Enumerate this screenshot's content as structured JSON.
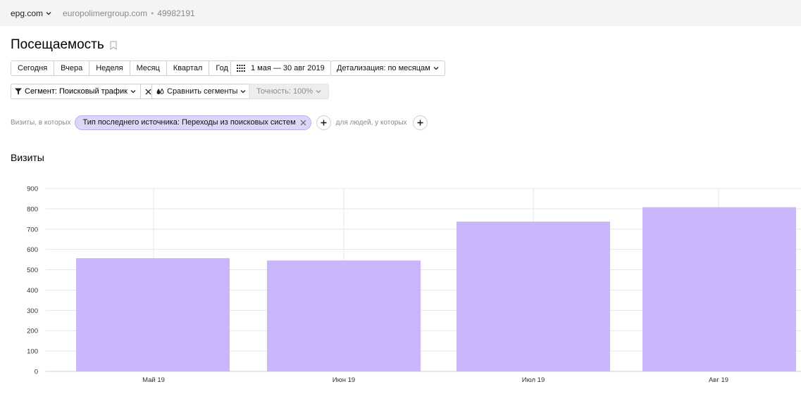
{
  "topbar": {
    "counter_name": "epg.com",
    "site": "europolimergroup.com",
    "separator": "•",
    "counter_id": "49982191"
  },
  "page": {
    "title": "Посещаемость"
  },
  "period_buttons": [
    "Сегодня",
    "Вчера",
    "Неделя",
    "Месяц",
    "Квартал",
    "Год"
  ],
  "date_range": {
    "label": "1 мая — 30 авг 2019"
  },
  "detail": {
    "label": "Детализация: по месяцам"
  },
  "segment": {
    "label": "Сегмент: Поисковый трафик"
  },
  "compare": {
    "label": "Сравнить сегменты"
  },
  "accuracy": {
    "label": "Точность: 100%"
  },
  "filters": {
    "visits_label": "Визиты, в которых",
    "chip": "Тип последнего источника: Переходы из поисковых систем",
    "people_label": "для людей, у которых"
  },
  "section": {
    "title": "Визиты"
  },
  "colors": {
    "bar": "#c9b6fb",
    "chip_bg": "#ddd7f7",
    "grid": "#e6e6e6"
  },
  "chart_data": {
    "type": "bar",
    "categories": [
      "Май 19",
      "Июн 19",
      "Июл 19",
      "Авг 19"
    ],
    "values": [
      557,
      546,
      737,
      808
    ],
    "ylim": [
      0,
      900
    ],
    "yticks": [
      0,
      100,
      200,
      300,
      400,
      500,
      600,
      700,
      800,
      900
    ],
    "grid": true,
    "title": "",
    "xlabel": "",
    "ylabel": ""
  }
}
